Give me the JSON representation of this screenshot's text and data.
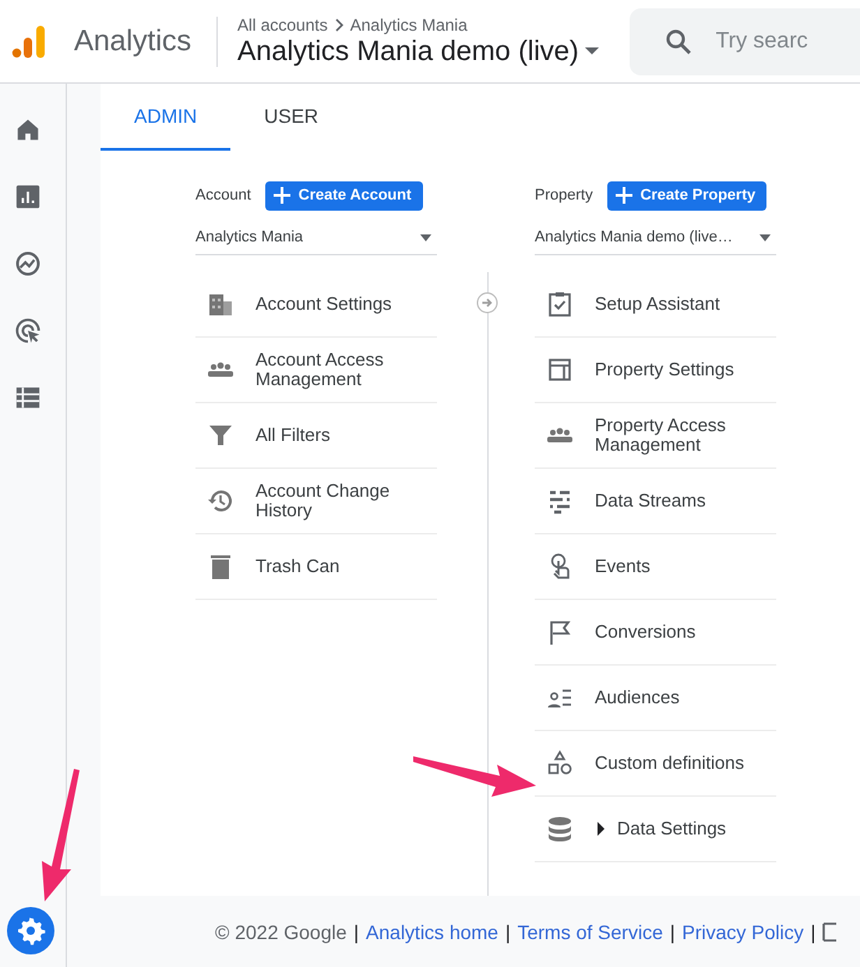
{
  "header": {
    "product": "Analytics",
    "breadcrumb": [
      "All accounts",
      "Analytics Mania"
    ],
    "title": "Analytics Mania demo (live)",
    "search": {
      "placeholder": "Try searc"
    }
  },
  "nav": [
    {
      "kind": "home",
      "selected": false
    },
    {
      "kind": "reports",
      "selected": false
    },
    {
      "kind": "explore",
      "selected": false
    },
    {
      "kind": "advertising",
      "selected": false
    },
    {
      "kind": "configure",
      "selected": false
    },
    {
      "kind": "admin",
      "selected": true
    }
  ],
  "tabs": [
    {
      "label": "ADMIN",
      "selected": true
    },
    {
      "label": "USER",
      "selected": false
    }
  ],
  "account": {
    "label": "Account",
    "button": "Create Account",
    "select": "Analytics Mania",
    "items": [
      {
        "kind": "building",
        "label": "Account Settings"
      },
      {
        "kind": "people",
        "label": "Account Access Management"
      },
      {
        "kind": "filter",
        "label": "All Filters"
      },
      {
        "kind": "history",
        "label": "Account Change History"
      },
      {
        "kind": "trash",
        "label": "Trash Can"
      }
    ]
  },
  "property": {
    "label": "Property",
    "button": "Create Property",
    "select": "Analytics Mania demo (live…",
    "items": [
      {
        "kind": "checklist",
        "label": "Setup Assistant"
      },
      {
        "kind": "layout",
        "label": "Property Settings"
      },
      {
        "kind": "people",
        "label": "Property Access Management"
      },
      {
        "kind": "streams",
        "label": "Data Streams"
      },
      {
        "kind": "touch",
        "label": "Events"
      },
      {
        "kind": "flag",
        "label": "Conversions"
      },
      {
        "kind": "audience",
        "label": "Audiences"
      },
      {
        "kind": "shapes",
        "label": "Custom definitions"
      },
      {
        "kind": "database",
        "label": "Data Settings",
        "expanded": false
      }
    ]
  },
  "footer": [
    {
      "kind": "text",
      "text": "© 2022 Google"
    },
    {
      "kind": "separator",
      "text": "|"
    },
    {
      "kind": "link",
      "text": "Analytics home"
    },
    {
      "kind": "separator",
      "text": "|"
    },
    {
      "kind": "link",
      "text": "Terms of Service"
    },
    {
      "kind": "separator",
      "text": "|"
    },
    {
      "kind": "link",
      "text": "Privacy Policy"
    },
    {
      "kind": "separator",
      "text": "|"
    }
  ]
}
